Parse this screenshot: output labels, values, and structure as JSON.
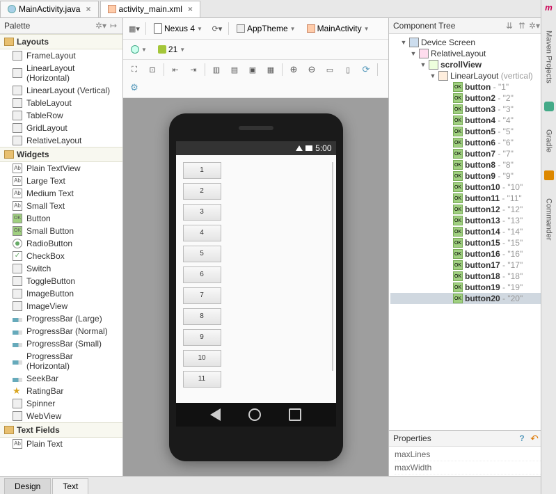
{
  "tabs": {
    "file1": "MainActivity.java",
    "file2": "activity_main.xml"
  },
  "palette": {
    "title": "Palette",
    "groups": {
      "layouts": {
        "title": "Layouts",
        "items": [
          "FrameLayout",
          "LinearLayout (Horizontal)",
          "LinearLayout (Vertical)",
          "TableLayout",
          "TableRow",
          "GridLayout",
          "RelativeLayout"
        ]
      },
      "widgets": {
        "title": "Widgets",
        "items": [
          "Plain TextView",
          "Large Text",
          "Medium Text",
          "Small Text",
          "Button",
          "Small Button",
          "RadioButton",
          "CheckBox",
          "Switch",
          "ToggleButton",
          "ImageButton",
          "ImageView",
          "ProgressBar (Large)",
          "ProgressBar (Normal)",
          "ProgressBar (Small)",
          "ProgressBar (Horizontal)",
          "SeekBar",
          "RatingBar",
          "Spinner",
          "WebView"
        ]
      },
      "textfields": {
        "title": "Text Fields",
        "items": [
          "Plain Text"
        ]
      }
    }
  },
  "designer_toolbar": {
    "device": "Nexus 4",
    "theme_label": "AppTheme",
    "activity_label": "MainActivity",
    "api": "21"
  },
  "phone": {
    "status_time": "5:00",
    "buttons": [
      "1",
      "2",
      "3",
      "4",
      "5",
      "6",
      "7",
      "8",
      "9",
      "10",
      "11"
    ]
  },
  "tree": {
    "title": "Component Tree",
    "root": "Device Screen",
    "rel": "RelativeLayout",
    "scroll": "scrollView",
    "lin": "LinearLayout",
    "lin_suffix": "(vertical)",
    "buttons": [
      {
        "name": "button",
        "text": "1"
      },
      {
        "name": "button2",
        "text": "2"
      },
      {
        "name": "button3",
        "text": "3"
      },
      {
        "name": "button4",
        "text": "4"
      },
      {
        "name": "button5",
        "text": "5"
      },
      {
        "name": "button6",
        "text": "6"
      },
      {
        "name": "button7",
        "text": "7"
      },
      {
        "name": "button8",
        "text": "8"
      },
      {
        "name": "button9",
        "text": "9"
      },
      {
        "name": "button10",
        "text": "10"
      },
      {
        "name": "button11",
        "text": "11"
      },
      {
        "name": "button12",
        "text": "12"
      },
      {
        "name": "button13",
        "text": "13"
      },
      {
        "name": "button14",
        "text": "14"
      },
      {
        "name": "button15",
        "text": "15"
      },
      {
        "name": "button16",
        "text": "16"
      },
      {
        "name": "button17",
        "text": "17"
      },
      {
        "name": "button18",
        "text": "18"
      },
      {
        "name": "button19",
        "text": "19"
      },
      {
        "name": "button20",
        "text": "20"
      }
    ]
  },
  "properties": {
    "title": "Properties",
    "rows": [
      "maxLines",
      "maxWidth"
    ]
  },
  "bottom_tabs": {
    "design": "Design",
    "text": "Text"
  },
  "gutter": {
    "maven": "Maven Projects",
    "gradle": "Gradle",
    "commander": "Commander"
  }
}
